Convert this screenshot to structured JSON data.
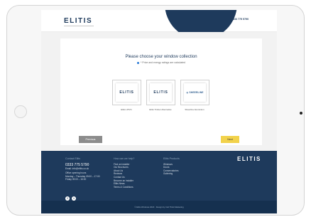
{
  "header": {
    "logo": "ELITIS",
    "nav": [
      "Security ⌄",
      "Find Quote",
      "Reviews"
    ],
    "nav_partial": "s ⌄",
    "phone": "0333 775 5790"
  },
  "main": {
    "heading": "Please choose your window collection",
    "subtitle": "* Price and energy ratings are calculated",
    "options": [
      {
        "logo": "ELITIS",
        "caption": "Elitis UPVC"
      },
      {
        "logo": "ELITIS",
        "caption": "Elitis Timber Alternative"
      },
      {
        "logo": "◎ SHEERLINE",
        "caption": "Sheerline Aluminium"
      }
    ],
    "previous_label": "Previous",
    "next_label": "Next"
  },
  "footer": {
    "contact": {
      "title": "Contact Elitis",
      "phone": "0333 775 5790",
      "email": "Email: info@elitis.co.uk",
      "hours_title": "Office opening hours",
      "hours_1": "Monday – Thursday 09:00 – 17:00",
      "hours_2": "Friday 09:00 – 16:00"
    },
    "help": {
      "title": "How can we help?",
      "links": [
        "Find an installer",
        "Our Brochures",
        "About Us",
        "Reviews",
        "Contact Us",
        "Become an installer",
        "Elitis News",
        "Terms & Conditions"
      ]
    },
    "products": {
      "title": "Elitis Products",
      "links": [
        "Windows",
        "Doors",
        "Conservatories",
        "Guttering"
      ]
    },
    "logo": "ELITIS",
    "social": [
      "facebook-icon",
      "twitter-icon"
    ],
    "copyright": "© Elitis Windows 2023 · Design by Cult Think Marketing"
  },
  "colors": {
    "brand": "#1e3a5c",
    "next_button": "#f2d24b",
    "previous_button": "#8c8c8c",
    "accent_dot": "#2a7bd6"
  }
}
